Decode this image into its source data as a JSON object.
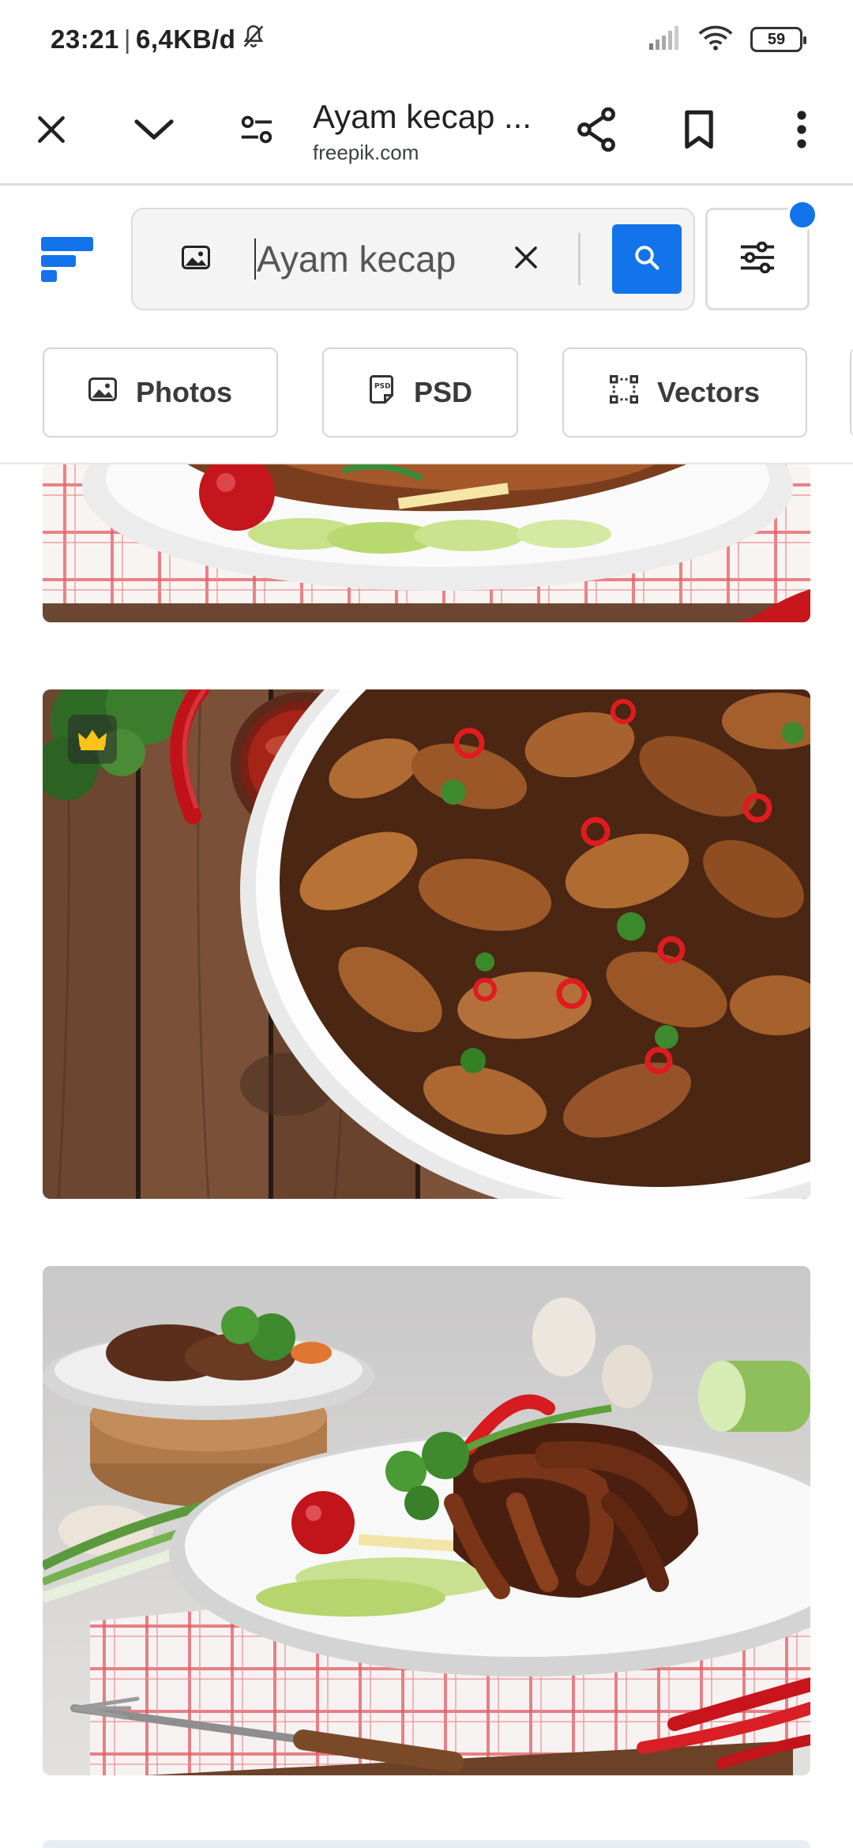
{
  "status_bar": {
    "time": "23:21",
    "network_speed": "6,4KB/d",
    "battery_level": "59",
    "icons": [
      "bell-off-icon",
      "signal-icon",
      "wifi-icon",
      "battery-icon"
    ]
  },
  "toolbar": {
    "page_title": "Ayam kecap ...",
    "domain": "freepik.com",
    "icons": [
      "close-icon",
      "chevron-down-icon",
      "site-settings-icon",
      "share-icon",
      "bookmark-icon",
      "more-vert-icon"
    ]
  },
  "search": {
    "query": "Ayam kecap",
    "icons": [
      "image-search-icon",
      "clear-icon",
      "search-icon",
      "filter-sliders-icon"
    ]
  },
  "filters": {
    "chips": [
      {
        "label": "Photos",
        "icon": "photo-icon"
      },
      {
        "label": "PSD",
        "icon": "psd-file-icon"
      },
      {
        "label": "Vectors",
        "icon": "vector-nodes-icon"
      }
    ]
  },
  "results": {
    "items": [
      {
        "subject": "chicken-wings-plate-cucumber-tablecloth",
        "premium": false
      },
      {
        "subject": "glazed-chicken-wings-baking-dish-chili-sauce",
        "premium": true,
        "badge_icon": "crown-icon"
      },
      {
        "subject": "glazed-chicken-feet-plate-vegetables",
        "premium": false
      }
    ]
  },
  "colors": {
    "accent_blue": "#1273eb",
    "premium_gold": "#fcc419"
  }
}
